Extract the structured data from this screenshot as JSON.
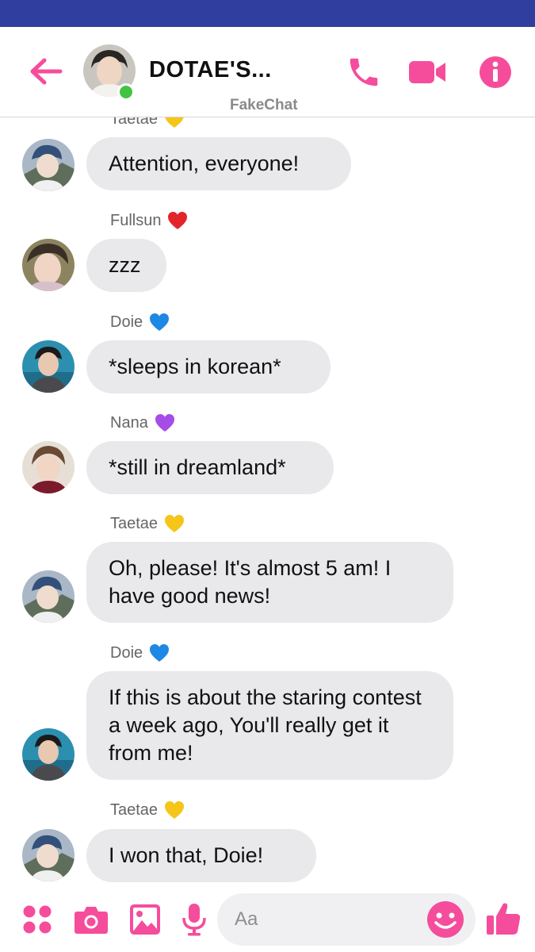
{
  "header": {
    "title": "DOTAE'S...",
    "subtitle": "FakeChat",
    "icons": [
      "back-arrow-icon",
      "phone-icon",
      "video-camera-icon",
      "info-icon"
    ],
    "accent_color": "#f54d9b",
    "status_bar_color": "#303f9f"
  },
  "partial_top": {
    "sender": "Taetae",
    "heart": "yellow"
  },
  "messages": [
    {
      "sender": "",
      "heart": "",
      "text": "Attention, everyone!",
      "avatar": "taetae"
    },
    {
      "sender": "Fullsun",
      "heart": "red",
      "text": "zzz",
      "avatar": "fullsun"
    },
    {
      "sender": "Doie",
      "heart": "blue",
      "text": "*sleeps in korean*",
      "avatar": "doie"
    },
    {
      "sender": "Nana",
      "heart": "purple",
      "text": "*still in dreamland*",
      "avatar": "nana"
    },
    {
      "sender": "Taetae",
      "heart": "yellow",
      "text": "Oh,  please!  It's almost 5 am! I have good news!",
      "avatar": "taetae"
    },
    {
      "sender": "Doie",
      "heart": "blue",
      "text": "If this is about the staring contest a week ago, You'll really get it from me!",
      "avatar": "doie"
    },
    {
      "sender": "Taetae",
      "heart": "yellow",
      "text": "I won that,  Doie!",
      "avatar": "taetae"
    }
  ],
  "composer": {
    "placeholder": "Aa",
    "icons": [
      "apps-grid-icon",
      "camera-icon",
      "image-icon",
      "microphone-icon",
      "emoji-icon",
      "thumbs-up-icon"
    ]
  },
  "heart_colors": {
    "yellow": "#f5c518",
    "red": "#e3242b",
    "blue": "#1e88e5",
    "purple": "#a64ce8"
  }
}
